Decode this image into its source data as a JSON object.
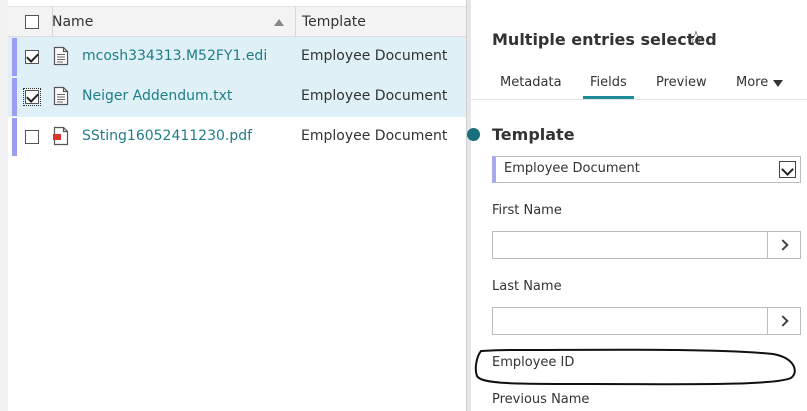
{
  "list": {
    "columns": {
      "name": "Name",
      "template": "Template"
    },
    "rows": [
      {
        "name": "mcosh334313.M52FY1.edi",
        "template": "Employee Document",
        "checked": true,
        "selected": true,
        "icon": "text-document-icon"
      },
      {
        "name": "Neiger Addendum.txt",
        "template": "Employee Document",
        "checked": true,
        "selected": true,
        "icon": "text-document-icon"
      },
      {
        "name": "SSting16052411230.pdf",
        "template": "Employee Document",
        "checked": false,
        "selected": false,
        "icon": "pdf-document-icon"
      }
    ]
  },
  "properties": {
    "title": "Multiple entries selected",
    "tabs": {
      "metadata": "Metadata",
      "fields": "Fields",
      "preview": "Preview",
      "more": "More"
    },
    "active_tab": "Fields",
    "section_title": "Template",
    "template_value": "Employee Document",
    "fields": {
      "first_name": {
        "label": "First Name",
        "value": ""
      },
      "last_name": {
        "label": "Last Name",
        "value": ""
      },
      "employee_id": {
        "label": "Employee ID"
      },
      "previous_name": {
        "label": "Previous Name"
      }
    }
  },
  "colors": {
    "link": "#1f7d89",
    "selected_row": "#dff1f6",
    "row_marker": "#9c9cf0",
    "accent": "#1f8a97"
  }
}
